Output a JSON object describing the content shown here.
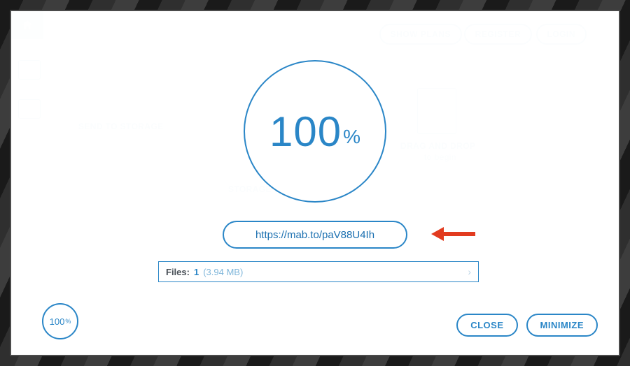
{
  "header": {
    "show_plans": "SHOW PLANS",
    "register": "REGISTER",
    "login": "LOGIN"
  },
  "background": {
    "send_to_storage": "SEND TO STORAGE",
    "storage": "STORAGE",
    "drag_drop_title": "DRAG AND DROP",
    "drag_drop_sub": "to begin"
  },
  "progress": {
    "value": "100",
    "percent_sign": "%",
    "mini_value": "100",
    "mini_percent_sign": "%"
  },
  "share": {
    "url": "https://mab.to/paV88U4Ih"
  },
  "files": {
    "label": "Files:",
    "count": "1",
    "size": "(3.94 MB)"
  },
  "footer": {
    "close": "CLOSE",
    "minimize": "MINIMIZE"
  }
}
